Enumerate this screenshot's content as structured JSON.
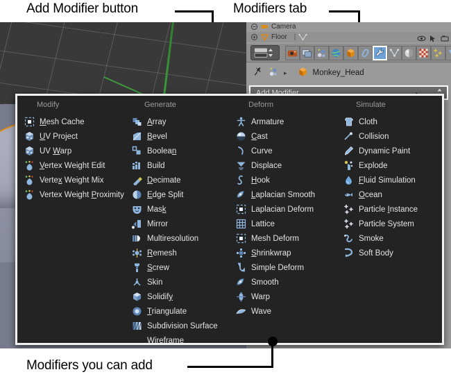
{
  "annotations": {
    "add_modifier_button": "Add Modifier button",
    "modifiers_tab": "Modifiers tab",
    "modifiers_you_can_add": "Modifiers you can add"
  },
  "colors": {
    "panel_bg": "#232323",
    "panel_border": "#f2f2f2",
    "properties_bg": "#9a9a9a",
    "active_tab": "#6ea2d6",
    "text": "#e3e3e3",
    "column_title": "#9a9a9a",
    "viewport_floor": "#777b8c",
    "viewport_sky": "#393939",
    "selection_outline": "#e08a12"
  },
  "outliner": {
    "rows": [
      {
        "label": "Camera",
        "icon": "camera-icon"
      },
      {
        "label": "Floor",
        "icon": "mesh-triangle-icon"
      }
    ],
    "right_icons": [
      "eye-icon",
      "cursor-arrow-icon",
      "camera-render-icon"
    ]
  },
  "properties_header": {
    "editor_type_icon": "editor-type-icon",
    "tabs": [
      {
        "name": "render",
        "icon": "camera-back-icon",
        "active": false
      },
      {
        "name": "render-layers",
        "icon": "images-icon",
        "active": false
      },
      {
        "name": "scene",
        "icon": "scene-icon",
        "active": false
      },
      {
        "name": "world",
        "icon": "world-globe-icon",
        "active": false
      },
      {
        "name": "object",
        "icon": "orange-cube-icon",
        "active": false
      },
      {
        "name": "constraints",
        "icon": "chain-link-icon",
        "active": false
      },
      {
        "name": "modifiers",
        "icon": "wrench-icon",
        "active": true
      },
      {
        "name": "data",
        "icon": "mesh-data-icon",
        "active": false
      },
      {
        "name": "material",
        "icon": "material-ball-icon",
        "active": false
      },
      {
        "name": "texture",
        "icon": "checker-icon",
        "active": false
      },
      {
        "name": "particles",
        "icon": "particles-icon",
        "active": false
      },
      {
        "name": "physics",
        "icon": "physics-icon",
        "active": false
      }
    ]
  },
  "breadcrumb": {
    "pin_icon": "pin-icon",
    "scene_icon": "scene-icon",
    "separator": "▸",
    "object_icon": "orange-cube-icon",
    "object_name": "Monkey_Head"
  },
  "add_modifier": {
    "label": "Add Modifier",
    "arrows": "▴▾",
    "cursor_icon": "mouse-cursor-icon"
  },
  "dropdown": {
    "columns": [
      {
        "title": "Modify",
        "items": [
          {
            "label": "Mesh Cache",
            "icon": "mesh-cache-icon",
            "accel": "M"
          },
          {
            "label": "UV Project",
            "icon": "uv-project-icon",
            "accel": "U"
          },
          {
            "label": "UV Warp",
            "icon": "uv-warp-icon",
            "accel": "W"
          },
          {
            "label": "Vertex Weight Edit",
            "icon": "vertex-weight-icon",
            "accel": "V"
          },
          {
            "label": "Vertex Weight Mix",
            "icon": "vertex-weight-icon",
            "accel": "x"
          },
          {
            "label": "Vertex Weight Proximity",
            "icon": "vertex-weight-icon",
            "accel": "P"
          }
        ]
      },
      {
        "title": "Generate",
        "items": [
          {
            "label": "Array",
            "icon": "array-icon",
            "accel": "A"
          },
          {
            "label": "Bevel",
            "icon": "bevel-icon",
            "accel": "B"
          },
          {
            "label": "Boolean",
            "icon": "boolean-icon",
            "accel": "n"
          },
          {
            "label": "Build",
            "icon": "build-icon",
            "accel": ""
          },
          {
            "label": "Decimate",
            "icon": "decimate-icon",
            "accel": "D"
          },
          {
            "label": "Edge Split",
            "icon": "edge-split-icon",
            "accel": "E"
          },
          {
            "label": "Mask",
            "icon": "mask-icon",
            "accel": "k"
          },
          {
            "label": "Mirror",
            "icon": "mirror-icon",
            "accel": ""
          },
          {
            "label": "Multiresolution",
            "icon": "multires-icon",
            "accel": ""
          },
          {
            "label": "Remesh",
            "icon": "remesh-icon",
            "accel": "R"
          },
          {
            "label": "Screw",
            "icon": "screw-icon",
            "accel": "S"
          },
          {
            "label": "Skin",
            "icon": "skin-icon",
            "accel": ""
          },
          {
            "label": "Solidify",
            "icon": "solidify-icon",
            "accel": "y"
          },
          {
            "label": "Subdivision Surface",
            "icon": "subsurf-icon",
            "accel": ""
          },
          {
            "label": "Triangulate",
            "icon": "triangulate-icon",
            "accel": "T"
          },
          {
            "label": "Wireframe",
            "icon": "",
            "accel": ""
          }
        ]
      },
      {
        "title": "Deform",
        "items": [
          {
            "label": "Armature",
            "icon": "armature-icon",
            "accel": ""
          },
          {
            "label": "Cast",
            "icon": "cast-icon",
            "accel": "C"
          },
          {
            "label": "Curve",
            "icon": "curve-icon",
            "accel": ""
          },
          {
            "label": "Displace",
            "icon": "displace-icon",
            "accel": ""
          },
          {
            "label": "Hook",
            "icon": "hook-icon",
            "accel": "H"
          },
          {
            "label": "Laplacian Smooth",
            "icon": "laplacian-smooth-icon",
            "accel": "L"
          },
          {
            "label": "Laplacian Deform",
            "icon": "laplacian-deform-icon",
            "accel": ""
          },
          {
            "label": "Lattice",
            "icon": "lattice-icon",
            "accel": ""
          },
          {
            "label": "Mesh Deform",
            "icon": "mesh-deform-icon",
            "accel": ""
          },
          {
            "label": "Shrinkwrap",
            "icon": "shrinkwrap-icon",
            "accel": "S"
          },
          {
            "label": "Simple Deform",
            "icon": "simple-deform-icon",
            "accel": ""
          },
          {
            "label": "Smooth",
            "icon": "smooth-icon",
            "accel": ""
          },
          {
            "label": "Warp",
            "icon": "warp-icon",
            "accel": ""
          },
          {
            "label": "Wave",
            "icon": "wave-icon",
            "accel": ""
          }
        ]
      },
      {
        "title": "Simulate",
        "items": [
          {
            "label": "Cloth",
            "icon": "cloth-icon",
            "accel": ""
          },
          {
            "label": "Collision",
            "icon": "collision-icon",
            "accel": ""
          },
          {
            "label": "Dynamic Paint",
            "icon": "dynamic-paint-icon",
            "accel": ""
          },
          {
            "label": "Explode",
            "icon": "explode-icon",
            "accel": ""
          },
          {
            "label": "Fluid Simulation",
            "icon": "fluid-icon",
            "accel": "F"
          },
          {
            "label": "Ocean",
            "icon": "ocean-icon",
            "accel": "O"
          },
          {
            "label": "Particle Instance",
            "icon": "particles-icon",
            "accel": "I"
          },
          {
            "label": "Particle System",
            "icon": "particles-icon",
            "accel": ""
          },
          {
            "label": "Smoke",
            "icon": "smoke-icon",
            "accel": ""
          },
          {
            "label": "Soft Body",
            "icon": "soft-body-icon",
            "accel": ""
          }
        ]
      }
    ]
  }
}
